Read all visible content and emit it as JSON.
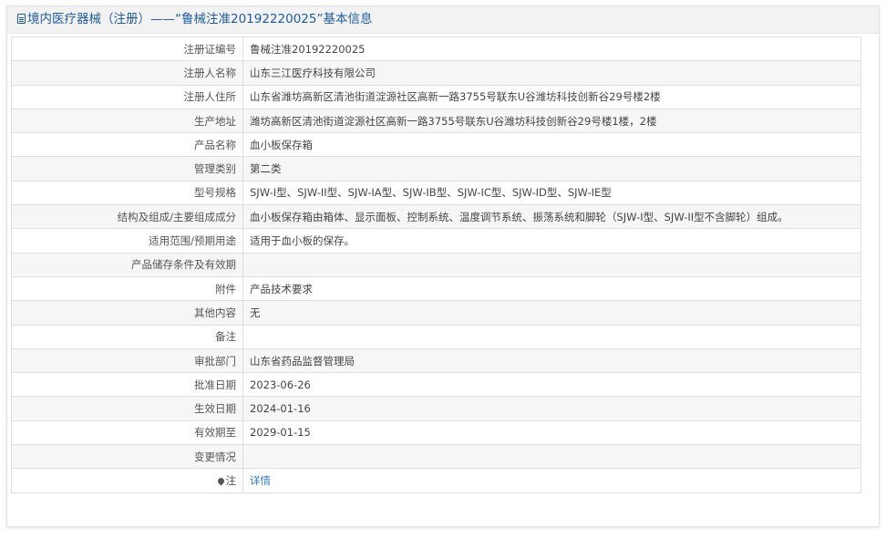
{
  "header": {
    "title": "境内医疗器械（注册）——“鲁械注准20192220025”基本信息",
    "icon": "document-icon"
  },
  "rows": [
    {
      "label": "注册证编号",
      "value": "鲁械注准20192220025"
    },
    {
      "label": "注册人名称",
      "value": "山东三江医疗科技有限公司"
    },
    {
      "label": "注册人住所",
      "value": "山东省潍坊高新区清池街道淀源社区高新一路3755号联东U谷潍坊科技创新谷29号楼2楼"
    },
    {
      "label": "生产地址",
      "value": "潍坊高新区清池街道淀源社区高新一路3755号联东U谷潍坊科技创新谷29号楼1楼，2楼"
    },
    {
      "label": "产品名称",
      "value": "血小板保存箱"
    },
    {
      "label": "管理类别",
      "value": "第二类"
    },
    {
      "label": "型号规格",
      "value": "SJW-I型、SJW-II型、SJW-IA型、SJW-IB型、SJW-IC型、SJW-ID型、SJW-IE型"
    },
    {
      "label": "结构及组成/主要组成成分",
      "value": "血小板保存箱由箱体、显示面板、控制系统、温度调节系统、振荡系统和脚轮（SJW-I型、SJW-II型不含脚轮）组成。"
    },
    {
      "label": "适用范围/预期用途",
      "value": "适用于血小板的保存。"
    },
    {
      "label": "产品储存条件及有效期",
      "value": ""
    },
    {
      "label": "附件",
      "value": "产品技术要求"
    },
    {
      "label": "其他内容",
      "value": "无"
    },
    {
      "label": "备注",
      "value": ""
    },
    {
      "label": "审批部门",
      "value": "山东省药品监督管理局"
    },
    {
      "label": "批准日期",
      "value": "2023-06-26"
    },
    {
      "label": "生效日期",
      "value": "2024-01-16"
    },
    {
      "label": "有效期至",
      "value": "2029-01-15"
    },
    {
      "label": "变更情况",
      "value": ""
    }
  ],
  "note": {
    "label": "注",
    "icon": "map-pin-icon",
    "link_text": "详情"
  },
  "colors": {
    "header_text": "#1f5b9c",
    "link": "#2d7bbf",
    "stripe": "#f6f6f6",
    "border": "#dedede"
  }
}
